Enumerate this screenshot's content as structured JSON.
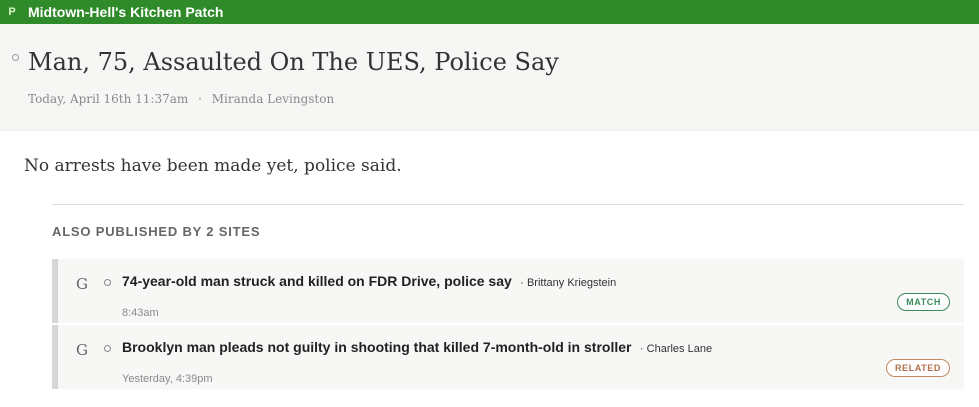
{
  "topbar": {
    "logo": "P",
    "title": "Midtown-Hell's Kitchen Patch"
  },
  "article": {
    "title": "Man, 75, Assaulted On The UES, Police Say",
    "timestamp": "Today, April 16th 11:37am",
    "separator": "·",
    "author": "Miranda Levingston",
    "summary": "No arrests have been made yet, police said."
  },
  "also_published": {
    "heading": "ALSO PUBLISHED BY 2 SITES",
    "items": [
      {
        "source_icon": "G",
        "headline": "74-year-old man struck and killed on FDR Drive, police say",
        "author": "· Brittany Kriegstein",
        "time": "8:43am",
        "badge": "MATCH"
      },
      {
        "source_icon": "G",
        "headline": "Brooklyn man pleads not guilty in shooting that killed 7-month-old in stroller",
        "author": "· Charles Lane",
        "time": "Yesterday, 4:39pm",
        "badge": "RELATED"
      }
    ]
  }
}
